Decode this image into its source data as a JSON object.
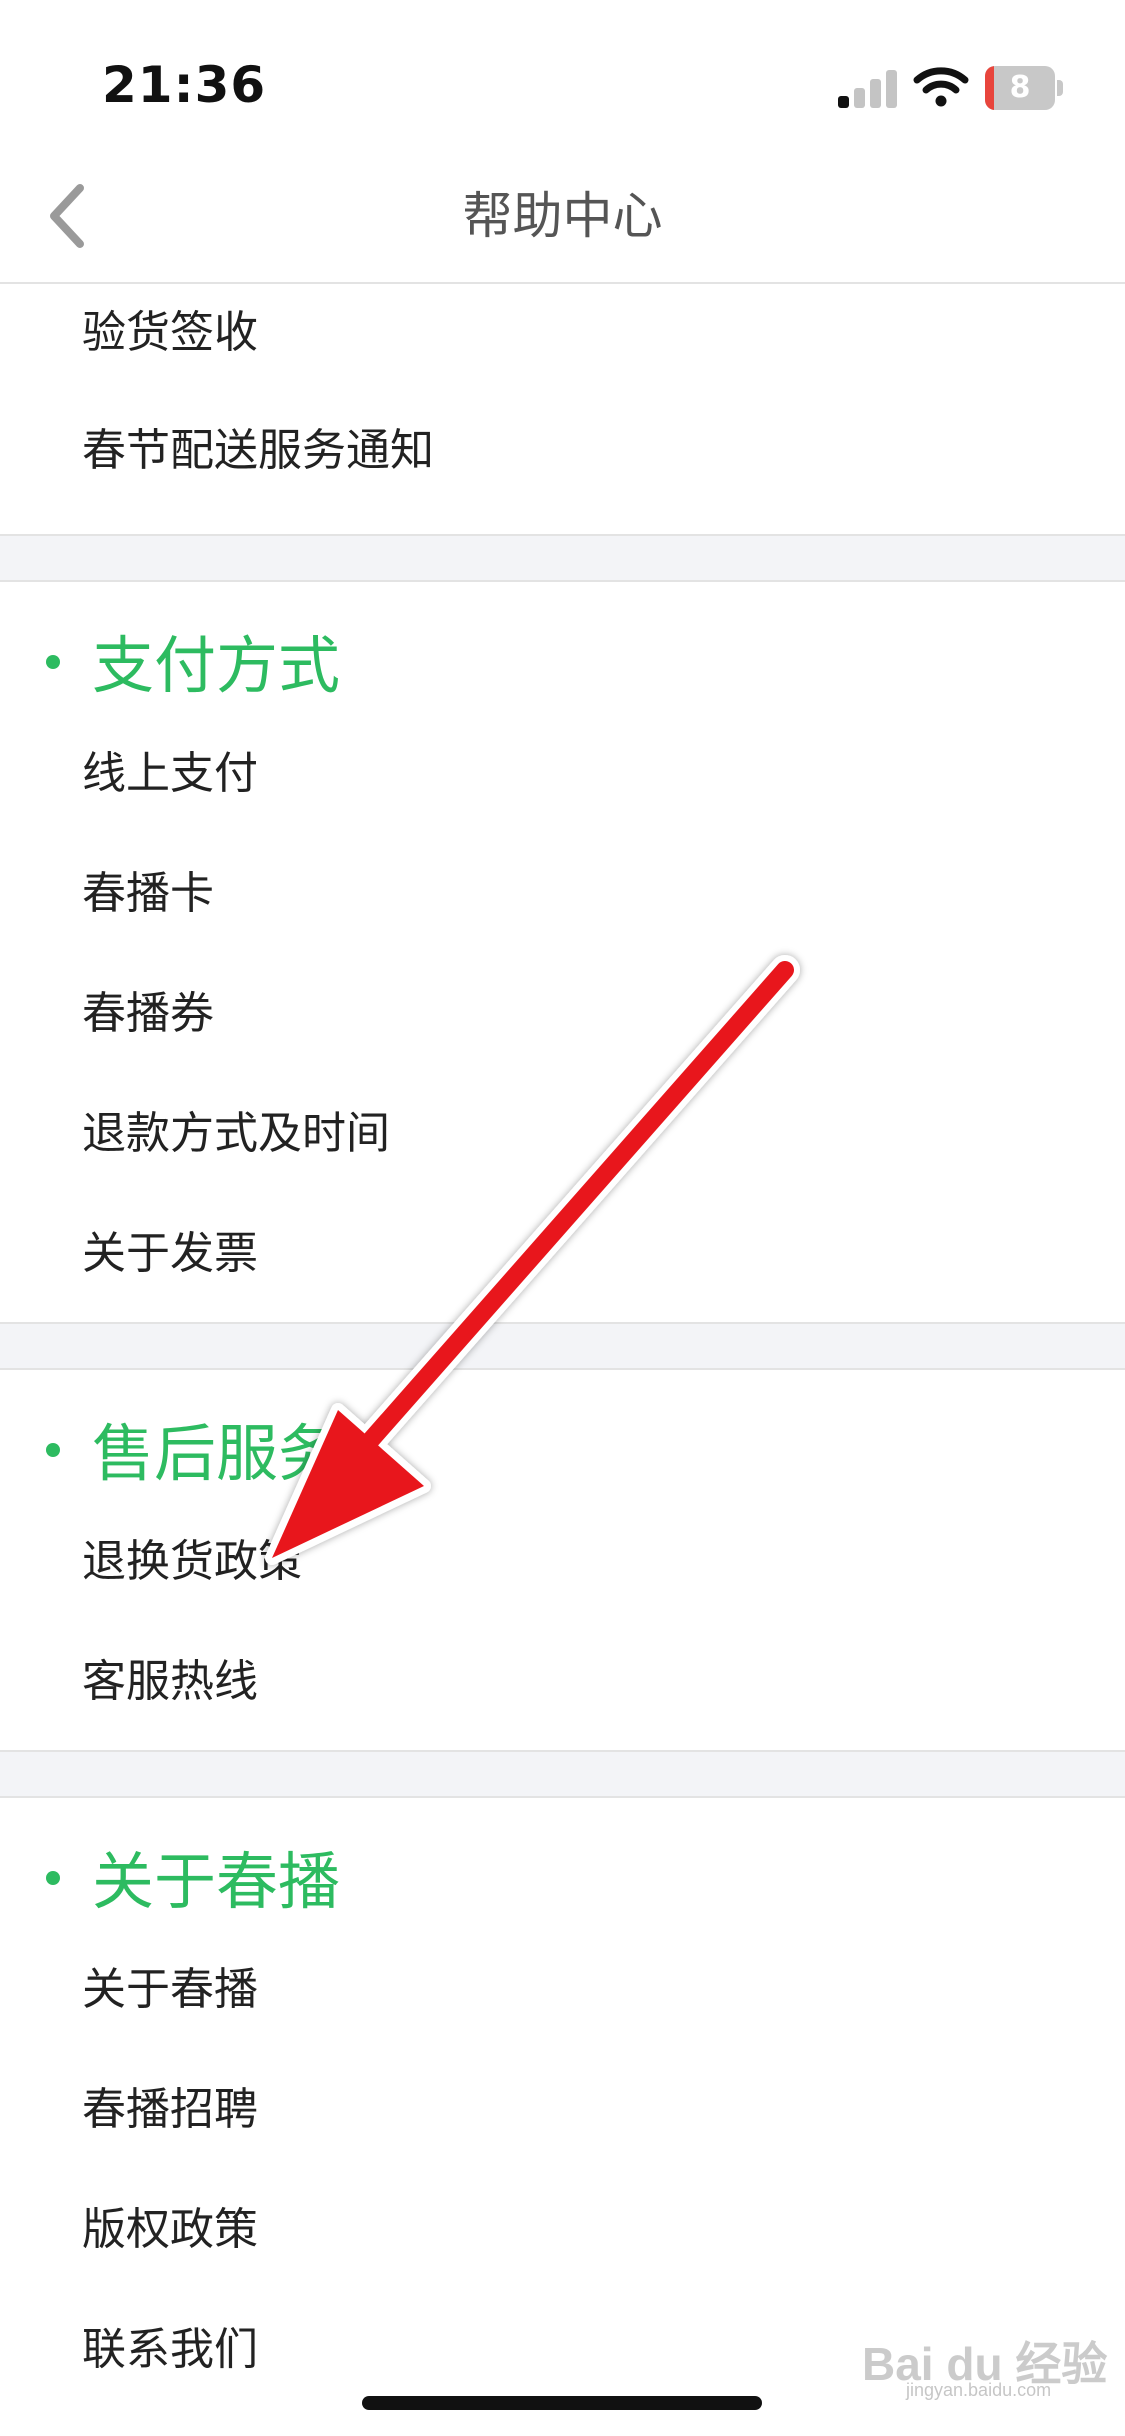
{
  "status_bar": {
    "time": "21:36",
    "battery_level": "8",
    "signal_bars_active": 1,
    "signal_bars_total": 4
  },
  "nav": {
    "title": "帮助中心",
    "back_icon": "chevron-left-icon"
  },
  "sections": [
    {
      "title": "",
      "items": [
        "验货签收",
        "春节配送服务通知"
      ]
    },
    {
      "title": "支付方式",
      "items": [
        "线上支付",
        "春播卡",
        "春播券",
        "退款方式及时间",
        "关于发票"
      ]
    },
    {
      "title": "售后服务",
      "items": [
        "退换货政策",
        "客服热线"
      ]
    },
    {
      "title": "关于春播",
      "items": [
        "关于春播",
        "春播招聘",
        "版权政策",
        "联系我们"
      ]
    }
  ],
  "watermark": {
    "logo_text": "Bai du 经验",
    "sub_text": "jingyan.baidu.com"
  },
  "colors": {
    "accent_green": "#2dbb60",
    "annotation_arrow": "#e8161c",
    "battery_low": "#e8453c"
  }
}
